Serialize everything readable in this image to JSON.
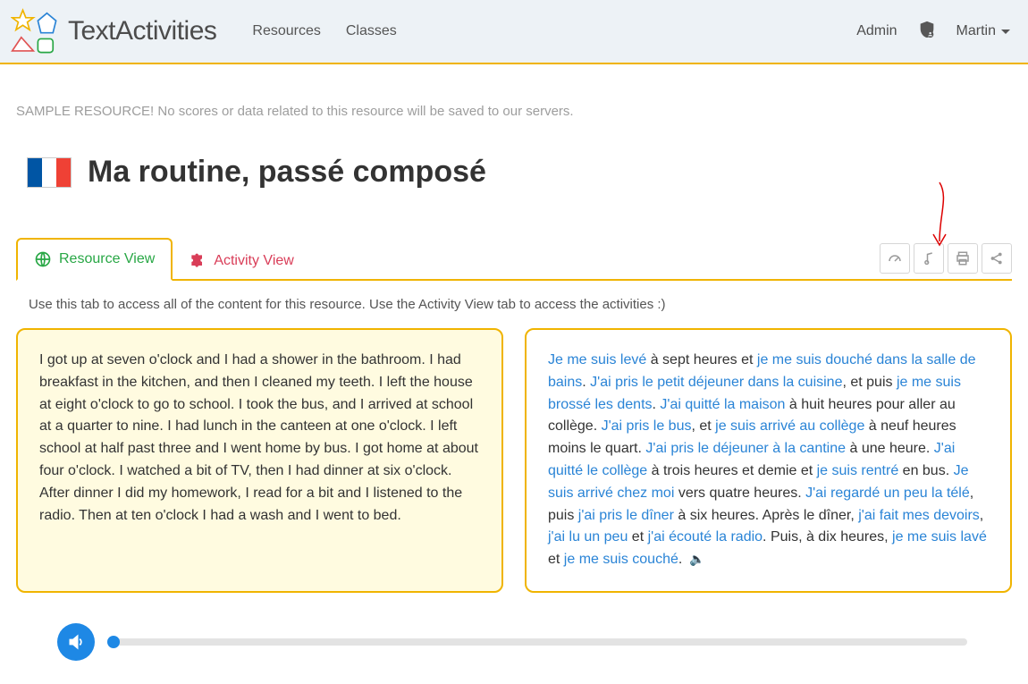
{
  "header": {
    "brand": "TextActivities",
    "nav": {
      "resources": "Resources",
      "classes": "Classes"
    },
    "admin_link": "Admin",
    "user_name": "Martin"
  },
  "sample_notice": "SAMPLE RESOURCE! No scores or data related to this resource will be saved to our servers.",
  "title": "Ma routine, passé composé",
  "tabs": {
    "resource": "Resource View",
    "activity": "Activity View"
  },
  "helper_text": "Use this tab to access all of the content for this resource. Use the Activity View tab to access the activities :)",
  "english_text": "I got up at seven o'clock and I had a shower in the bathroom. I had breakfast in the kitchen, and then I cleaned my teeth. I left the house at eight o'clock to go to school. I took the bus, and I arrived at school at a quarter to nine. I had lunch in the canteen at one o'clock. I left school at half past three and I went home by bus. I got home at about four o'clock. I watched a bit of TV, then I had dinner at six o'clock. After dinner I did my homework, I read for a bit and I listened to the radio. Then at ten o'clock I had a wash and I went to bed.",
  "french_segments": [
    {
      "t": "Je me suis levé",
      "h": true
    },
    {
      "t": " à sept heures et ",
      "h": false
    },
    {
      "t": "je me suis douché dans la salle de bains",
      "h": true
    },
    {
      "t": ". ",
      "h": false
    },
    {
      "t": "J'ai pris le petit déjeuner dans la cuisine",
      "h": true
    },
    {
      "t": ", et puis ",
      "h": false
    },
    {
      "t": "je me suis brossé les dents",
      "h": true
    },
    {
      "t": ". ",
      "h": false
    },
    {
      "t": "J'ai quitté la maison",
      "h": true
    },
    {
      "t": " à huit heures pour aller au collège. ",
      "h": false
    },
    {
      "t": "J'ai pris le bus",
      "h": true
    },
    {
      "t": ", et ",
      "h": false
    },
    {
      "t": "je suis arrivé au collège",
      "h": true
    },
    {
      "t": " à neuf heures moins le quart. ",
      "h": false
    },
    {
      "t": "J'ai pris le déjeuner à la cantine",
      "h": true
    },
    {
      "t": " à une heure. ",
      "h": false
    },
    {
      "t": "J'ai quitté le collège",
      "h": true
    },
    {
      "t": " à trois heures et demie et ",
      "h": false
    },
    {
      "t": "je suis rentré",
      "h": true
    },
    {
      "t": " en bus. ",
      "h": false
    },
    {
      "t": "Je suis arrivé chez moi",
      "h": true
    },
    {
      "t": " vers quatre heures. ",
      "h": false
    },
    {
      "t": "J'ai regardé un peu la télé",
      "h": true
    },
    {
      "t": ", puis ",
      "h": false
    },
    {
      "t": "j'ai pris le dîner",
      "h": true
    },
    {
      "t": " à six heures. Après le dîner, ",
      "h": false
    },
    {
      "t": "j'ai fait mes devoirs",
      "h": true
    },
    {
      "t": ", ",
      "h": false
    },
    {
      "t": "j'ai lu un peu",
      "h": true
    },
    {
      "t": " et ",
      "h": false
    },
    {
      "t": "j'ai écouté la radio",
      "h": true
    },
    {
      "t": ". Puis, à dix heures, ",
      "h": false
    },
    {
      "t": "je me suis lavé",
      "h": true
    },
    {
      "t": " et ",
      "h": false
    },
    {
      "t": "je me suis couché",
      "h": true
    },
    {
      "t": ".",
      "h": false
    }
  ]
}
